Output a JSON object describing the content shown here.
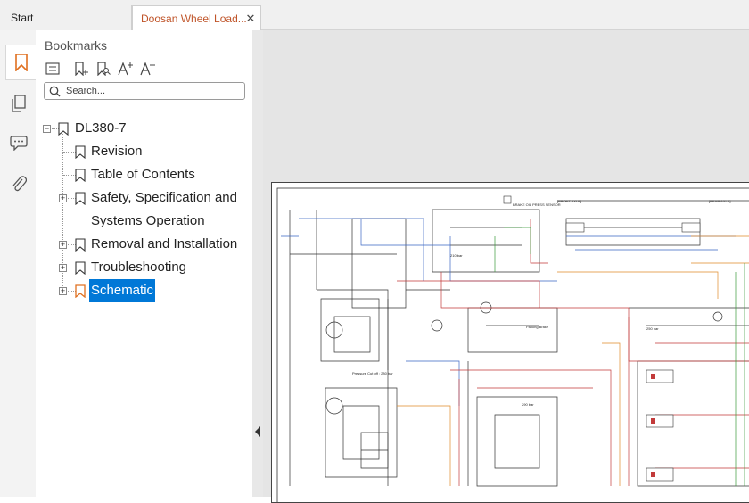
{
  "tabs": [
    {
      "label": "Start"
    },
    {
      "label": "Doosan Wheel Load...",
      "close": "✕"
    }
  ],
  "rail": {
    "icons": [
      "bookmark-icon",
      "pages-icon",
      "comment-icon",
      "attachment-icon"
    ]
  },
  "bookmarks_panel": {
    "title": "Bookmarks",
    "toolbar": [
      "expand-all-icon",
      "add-bookmark-icon",
      "find-bookmark-icon",
      "increase-font-icon",
      "decrease-font-icon"
    ],
    "search_placeholder": "Search...",
    "tree": {
      "root": "DL380-7",
      "items": [
        {
          "label": "Revision",
          "expandable": false
        },
        {
          "label": "Table of Contents",
          "expandable": false
        },
        {
          "label_line1": "Safety, Specification and",
          "label_line2": "Systems Operation",
          "expandable": true
        },
        {
          "label": "Removal and Installation",
          "expandable": true
        },
        {
          "label": "Troubleshooting",
          "expandable": true
        },
        {
          "label": "Schematic",
          "expandable": true,
          "selected": true
        }
      ]
    }
  },
  "schematic_labels": {
    "front_axle": "[FRONT AXLE]",
    "rear_axle": "[REAR AXLE]",
    "brake_oil_pressure_sensor": "BRAKE OIL PRESS SENSOR",
    "parking_brake": "Parking Brake",
    "pressure_cutoff": "Pressure Cut off : 280 bar",
    "bar_250": "250 bar",
    "bar_290": "290 bar",
    "bar_210": "210 bar"
  },
  "colors": {
    "accent": "#c0552a",
    "selection": "#0078d7",
    "bookmark_selected": "#e07020"
  }
}
